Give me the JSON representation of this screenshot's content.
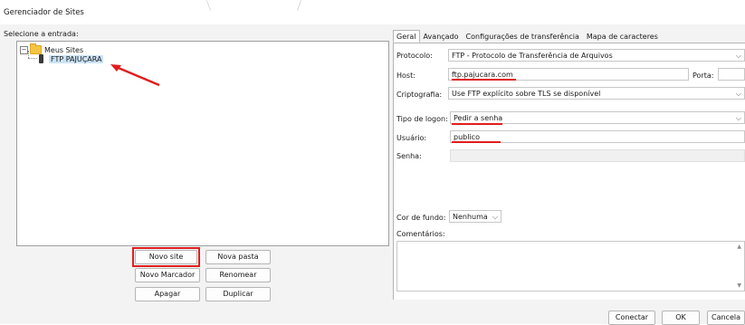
{
  "window": {
    "title": "Gerenciador de Sites"
  },
  "left": {
    "label": "Selecione a entrada:",
    "tree": {
      "root": "Meus Sites",
      "child": "FTP PAJUÇARA"
    },
    "buttons": {
      "new_site": "Novo site",
      "new_folder": "Nova pasta",
      "new_bookmark": "Novo Marcador",
      "rename": "Renomear",
      "delete": "Apagar",
      "duplicate": "Duplicar"
    }
  },
  "tabs": [
    "Geral",
    "Avançado",
    "Configurações de transferência",
    "Mapa de caracteres"
  ],
  "general": {
    "protocol_label": "Protocolo:",
    "protocol_value": "FTP - Protocolo de Transferência de Arquivos",
    "host_label": "Host:",
    "host_value": "ftp.pajucara.com",
    "port_label": "Porta:",
    "port_value": "",
    "encryption_label": "Criptografia:",
    "encryption_value": "Use FTP explícito sobre TLS se disponível",
    "logon_label": "Tipo de logon:",
    "logon_value": "Pedir a senha",
    "user_label": "Usuário:",
    "user_value": "publico",
    "password_label": "Senha:",
    "password_value": "",
    "bg_color_label": "Cor de fundo:",
    "bg_color_value": "Nenhuma",
    "comments_label": "Comentários:",
    "comments_value": ""
  },
  "footer": {
    "connect": "Conectar",
    "ok": "OK",
    "cancel": "Cancela"
  },
  "colors": {
    "highlight": "#e01e1e",
    "selection": "#cce3f7",
    "folder": "#f4c542"
  },
  "icons": [
    "folder-icon",
    "server-icon",
    "chevron-down-icon",
    "arrow-icon"
  ]
}
